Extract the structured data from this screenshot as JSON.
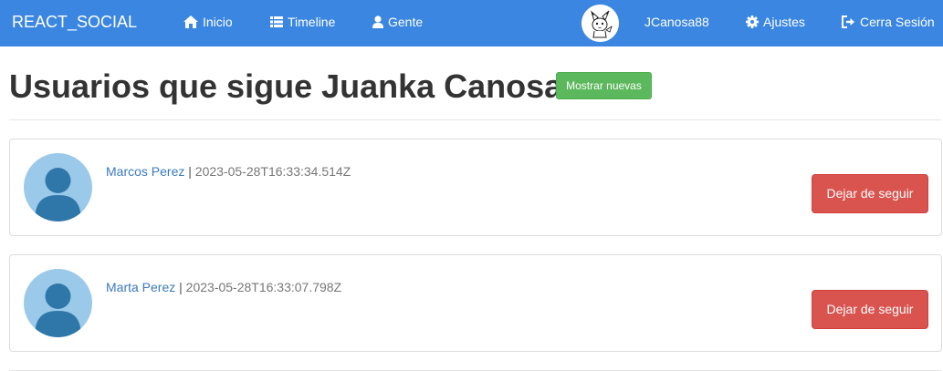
{
  "navbar": {
    "brand": "REACT_SOCIAL",
    "items": [
      {
        "label": "Inicio",
        "icon": "home-icon"
      },
      {
        "label": "Timeline",
        "icon": "list-icon"
      },
      {
        "label": "Gente",
        "icon": "user-icon"
      }
    ],
    "username": "JCanosa88",
    "settings_label": "Ajustes",
    "settings_icon": "gear-icon",
    "logout_label": "Cerra Sesión",
    "logout_icon": "logout-icon",
    "avatar_icon": "pikachu-avatar"
  },
  "page": {
    "title": "Usuarios que sigue Juanka Canosa",
    "show_new_label": "Mostrar nuevas"
  },
  "users": [
    {
      "name": "Marcos Perez",
      "separator": " | ",
      "date": "2023-05-28T16:33:34.514Z",
      "unfollow_label": "Dejar de seguir"
    },
    {
      "name": "Marta Perez",
      "separator": " | ",
      "date": "2023-05-28T16:33:07.798Z",
      "unfollow_label": "Dejar de seguir"
    }
  ],
  "colors": {
    "navbar": "#3a86e0",
    "success": "#5cb85c",
    "danger": "#d9534f",
    "link": "#3b7abc",
    "avatar_bg": "#9ac9ea",
    "avatar_fg": "#2f77a8"
  }
}
